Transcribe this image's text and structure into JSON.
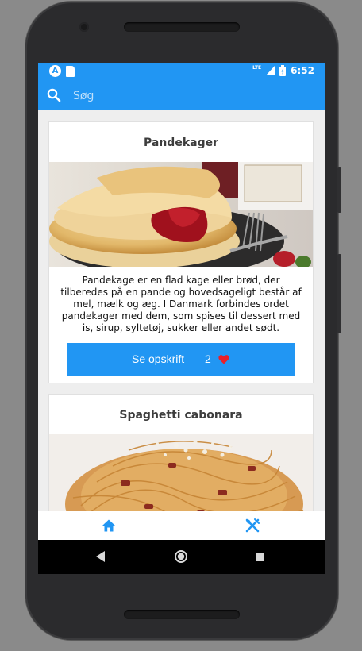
{
  "status_bar": {
    "left_icons": [
      "app-a-icon",
      "sd-card-icon"
    ],
    "a_glyph": "A",
    "network_label": "LTE",
    "right_icons": [
      "signal-icon",
      "battery-icon"
    ],
    "time": "6:52"
  },
  "toolbar": {
    "search_placeholder": "Søg",
    "search_icon": "search-icon"
  },
  "recipes": [
    {
      "title": "Pandekager",
      "image": "pancakes-photo",
      "description": "Pandekage er en flad kage eller brød, der tilberedes på en pande og hovedsageligt består af mel, mælk og æg. I Danmark forbindes ordet pandekager med dem, som spises til dessert med is, sirup, syltetøj, sukker eller andet sødt.",
      "button_label": "Se opskrift",
      "likes": "2",
      "heart_icon": "heart-icon"
    },
    {
      "title": "Spaghetti cabonara",
      "image": "spaghetti-photo"
    }
  ],
  "bottom_nav": {
    "items": [
      "home-icon",
      "recipes-icon"
    ]
  },
  "system_nav": {
    "items": [
      "back-icon",
      "home-circle-icon",
      "recents-icon"
    ]
  },
  "colors": {
    "accent": "#2196f3",
    "heart": "#e8202a",
    "background": "#eeeeee"
  }
}
